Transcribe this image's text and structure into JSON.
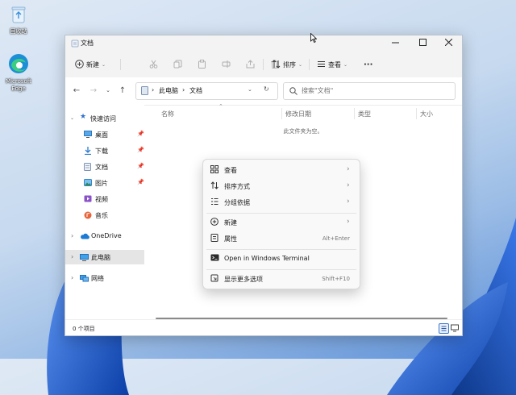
{
  "desktop": {
    "recycle_bin_label": "回收站",
    "edge_label_line1": "Microsoft",
    "edge_label_line2": "Edge"
  },
  "window": {
    "title": "文档",
    "toolbar": {
      "new_label": "新建",
      "sort_label": "排序",
      "view_label": "查看",
      "more_label": "···"
    },
    "address": {
      "segments": [
        "此电脑",
        "文档"
      ],
      "search_placeholder": "搜索\"文档\""
    },
    "sidebar": {
      "quick_access": "快速访问",
      "items": [
        {
          "label": "桌面",
          "pinned": true
        },
        {
          "label": "下载",
          "pinned": true
        },
        {
          "label": "文档",
          "pinned": true
        },
        {
          "label": "图片",
          "pinned": true
        },
        {
          "label": "视频",
          "pinned": false
        },
        {
          "label": "音乐",
          "pinned": false
        }
      ],
      "onedrive": "OneDrive",
      "this_pc": "此电脑",
      "network": "网络"
    },
    "columns": [
      "名称",
      "修改日期",
      "类型",
      "大小"
    ],
    "empty_message": "此文件夹为空。",
    "status": "0 个项目"
  },
  "context_menu": {
    "items": [
      {
        "label": "查看",
        "icon": "grid-icon",
        "submenu": true,
        "shortcut": ""
      },
      {
        "label": "排序方式",
        "icon": "sort-icon",
        "submenu": true,
        "shortcut": ""
      },
      {
        "label": "分组依据",
        "icon": "group-icon",
        "submenu": true,
        "shortcut": ""
      },
      {
        "label": "新建",
        "icon": "new-icon",
        "submenu": true,
        "shortcut": ""
      },
      {
        "label": "属性",
        "icon": "properties-icon",
        "submenu": false,
        "shortcut": "Alt+Enter"
      },
      {
        "label": "Open in Windows Terminal",
        "icon": "terminal-icon",
        "submenu": false,
        "shortcut": ""
      },
      {
        "label": "显示更多选项",
        "icon": "more-options-icon",
        "submenu": false,
        "shortcut": "Shift+F10"
      }
    ]
  },
  "colors": {
    "accent": "#0067c0",
    "folder": "#f3c34a",
    "selection": "#e5e5e5"
  }
}
